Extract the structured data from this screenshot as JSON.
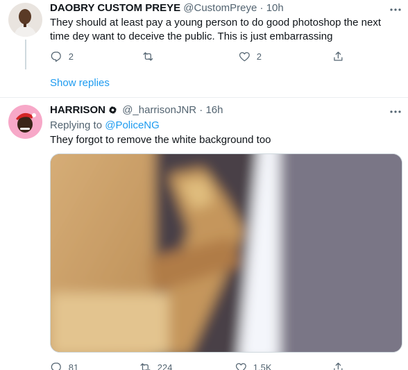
{
  "tweets": [
    {
      "display_name": "DAOBRY CUSTOM PREYE",
      "handle": "@CustomPreye",
      "dot": "·",
      "time": "10h",
      "text": "They should at least pay a young person to do good photoshop the next time dey want to deceive the public. This is just embarrassing",
      "actions": {
        "replies": "2",
        "retweets": "",
        "likes": "2",
        "share": ""
      }
    },
    {
      "display_name": "HARRISON",
      "handle": "@_harrisonJNR",
      "dot": "·",
      "time": "16h",
      "replying_prefix": "Replying to ",
      "replying_to": "@PoliceNG",
      "text": "They forgot to remove the white background too",
      "actions": {
        "replies": "81",
        "retweets": "224",
        "likes": "1.5K",
        "share": ""
      }
    }
  ],
  "show_replies": "Show replies",
  "icons": {
    "verified": "gear-badge-icon",
    "more": "more-horizontal-icon",
    "reply": "reply-icon",
    "retweet": "retweet-icon",
    "like": "heart-icon",
    "share": "share-icon"
  },
  "colors": {
    "link": "#1d9bf0",
    "muted": "#536471",
    "text": "#0f1419"
  }
}
